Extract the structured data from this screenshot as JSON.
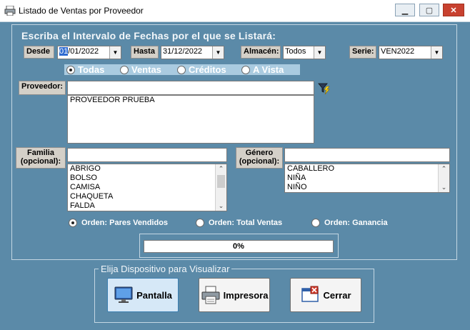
{
  "window": {
    "title": "Listado de Ventas por Proveedor",
    "minimize": "▁",
    "maximize": "▢",
    "close": "✕"
  },
  "heading": "Escriba el Intervalo de Fechas por el que se Listará:",
  "desde": {
    "label": "Desde",
    "value_sel": "01",
    "value_rest": "/01/2022"
  },
  "hasta": {
    "label": "Hasta",
    "value": "31/12/2022"
  },
  "almacen": {
    "label": "Almacén:",
    "value": "Todos"
  },
  "serie": {
    "label": "Serie:",
    "value": "VEN2022"
  },
  "tipo_radios": [
    {
      "label": "Todas",
      "selected": true
    },
    {
      "label": "Ventas",
      "selected": false
    },
    {
      "label": "Créditos",
      "selected": false
    },
    {
      "label": "A Vista",
      "selected": false
    }
  ],
  "proveedor": {
    "label": "Proveedor:",
    "input_value": "",
    "items": [
      "PROVEEDOR PRUEBA"
    ]
  },
  "familia": {
    "label_line1": "Familia",
    "label_line2": "(opcional):",
    "input_value": "",
    "items": [
      "ABRIGO",
      "BOLSO",
      "CAMISA",
      "CHAQUETA",
      "FALDA"
    ]
  },
  "genero": {
    "label_line1": "Género",
    "label_line2": "(opcional):",
    "input_value": "",
    "items": [
      "CABALLERO",
      "NIÑA",
      "NIÑO"
    ]
  },
  "orden_radios": [
    {
      "label": "Orden: Pares Vendidos",
      "selected": true
    },
    {
      "label": "Orden: Total Ventas",
      "selected": false
    },
    {
      "label": "Orden: Ganancia",
      "selected": false
    }
  ],
  "progress": {
    "percent_text": "0%",
    "value": 0
  },
  "dispositivo": {
    "title": "Elija Dispositivo para Visualizar",
    "pantalla": "Pantalla",
    "impresora": "Impresora",
    "cerrar": "Cerrar"
  },
  "icons": {
    "app": "printer-icon",
    "filter": "filter-lightning-icon",
    "monitor": "monitor-icon",
    "printer": "printer-icon",
    "close": "close-window-icon"
  }
}
